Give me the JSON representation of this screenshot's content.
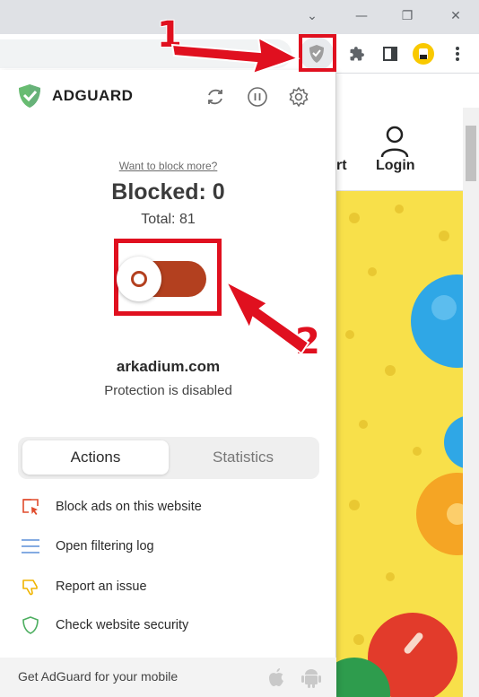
{
  "browser": {
    "window_controls": {
      "dropdown": "⌄",
      "minimize": "—",
      "restore": "❐",
      "close": "✕"
    }
  },
  "webpage": {
    "cart_label": "rt",
    "login_label": "Login"
  },
  "popup": {
    "brand": "ADGUARD",
    "want_more": "Want to block more?",
    "blocked": "Blocked: 0",
    "total": "Total: 81",
    "protection_enabled": false,
    "domain": "arkadium.com",
    "status": "Protection is disabled",
    "tabs": [
      {
        "label": "Actions",
        "selected": true
      },
      {
        "label": "Statistics",
        "selected": false
      }
    ],
    "actions": [
      {
        "label": "Block ads on this website",
        "icon": "block-ads-icon"
      },
      {
        "label": "Open filtering log",
        "icon": "filtering-log-icon"
      },
      {
        "label": "Report an issue",
        "icon": "thumbs-down-icon"
      },
      {
        "label": "Check website security",
        "icon": "shield-outline-icon"
      }
    ],
    "footer": "Get AdGuard for your mobile"
  },
  "annotations": {
    "step1": "1",
    "step2": "2"
  },
  "colors": {
    "brand_green": "#68bc71",
    "toggle_off": "#b3401f",
    "highlight_red": "#e0101f"
  }
}
